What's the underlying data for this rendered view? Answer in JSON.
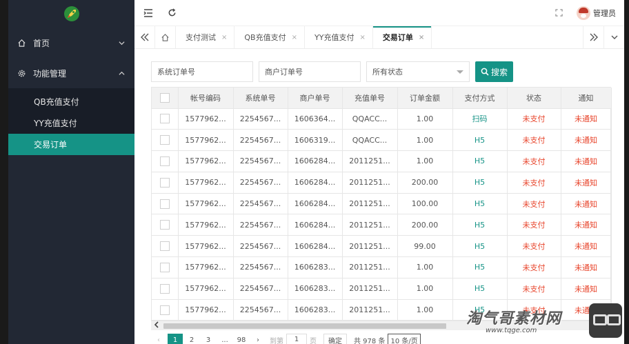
{
  "colors": {
    "accent": "#159386",
    "danger": "#e8452c",
    "sidebar": "#222834"
  },
  "sidebar": {
    "groups": [
      {
        "label": "首页",
        "icon": "home-icon",
        "expanded": false
      },
      {
        "label": "功能管理",
        "icon": "gear-icon",
        "expanded": true,
        "items": [
          {
            "label": "QB充值支付",
            "active": false
          },
          {
            "label": "YY充值支付",
            "active": false
          },
          {
            "label": "交易订单",
            "active": true
          }
        ]
      }
    ]
  },
  "topbar": {
    "user": "管理员"
  },
  "tabs": [
    {
      "label": "支付测试",
      "active": false
    },
    {
      "label": "QB充值支付",
      "active": false
    },
    {
      "label": "YY充值支付",
      "active": false
    },
    {
      "label": "交易订单",
      "active": true
    }
  ],
  "tab_close": "×",
  "filters": {
    "system_order_placeholder": "系统订单号",
    "merchant_order_placeholder": "商户订单号",
    "status_value": "所有状态",
    "search_label": "搜索"
  },
  "table": {
    "headers": [
      "帐号编码",
      "系统单号",
      "商户单号",
      "充值单号",
      "订单金额",
      "支付方式",
      "状态",
      "通知"
    ],
    "rows": [
      [
        "1577962...",
        "2254567...",
        "1606364...",
        "QQACC...",
        "1.00",
        "扫码",
        "未支付",
        "未通知"
      ],
      [
        "1577962...",
        "2254567...",
        "1606319...",
        "QQACC...",
        "1.00",
        "H5",
        "未支付",
        "未通知"
      ],
      [
        "1577962...",
        "2254567...",
        "1606284...",
        "2011251...",
        "1.00",
        "H5",
        "未支付",
        "未通知"
      ],
      [
        "1577962...",
        "2254567...",
        "1606284...",
        "2011251...",
        "200.00",
        "H5",
        "未支付",
        "未通知"
      ],
      [
        "1577962...",
        "2254567...",
        "1606284...",
        "2011251...",
        "100.00",
        "H5",
        "未支付",
        "未通知"
      ],
      [
        "1577962...",
        "2254567...",
        "1606284...",
        "2011251...",
        "200.00",
        "H5",
        "未支付",
        "未通知"
      ],
      [
        "1577962...",
        "2254567...",
        "1606284...",
        "2011251...",
        "99.00",
        "H5",
        "未支付",
        "未通知"
      ],
      [
        "1577962...",
        "2254567...",
        "1606283...",
        "2011251...",
        "1.00",
        "H5",
        "未支付",
        "未通知"
      ],
      [
        "1577962...",
        "2254567...",
        "1606283...",
        "2011251...",
        "1.00",
        "H5",
        "未支付",
        "未通知"
      ],
      [
        "1577962...",
        "2254567...",
        "1606283...",
        "2011251...",
        "1.00",
        "H5",
        "未支付",
        "未通知"
      ]
    ]
  },
  "pager": {
    "prev": "‹",
    "pages": [
      "1",
      "2",
      "3",
      "...",
      "98"
    ],
    "current": "1",
    "next": "›",
    "goto_label": "到第",
    "goto_value": "1",
    "page_unit": "页",
    "confirm": "确定",
    "total": "共 978 条",
    "size": "10 条/页"
  },
  "watermark": {
    "text": "淘气哥素材网",
    "url": "www.tqge.com"
  }
}
